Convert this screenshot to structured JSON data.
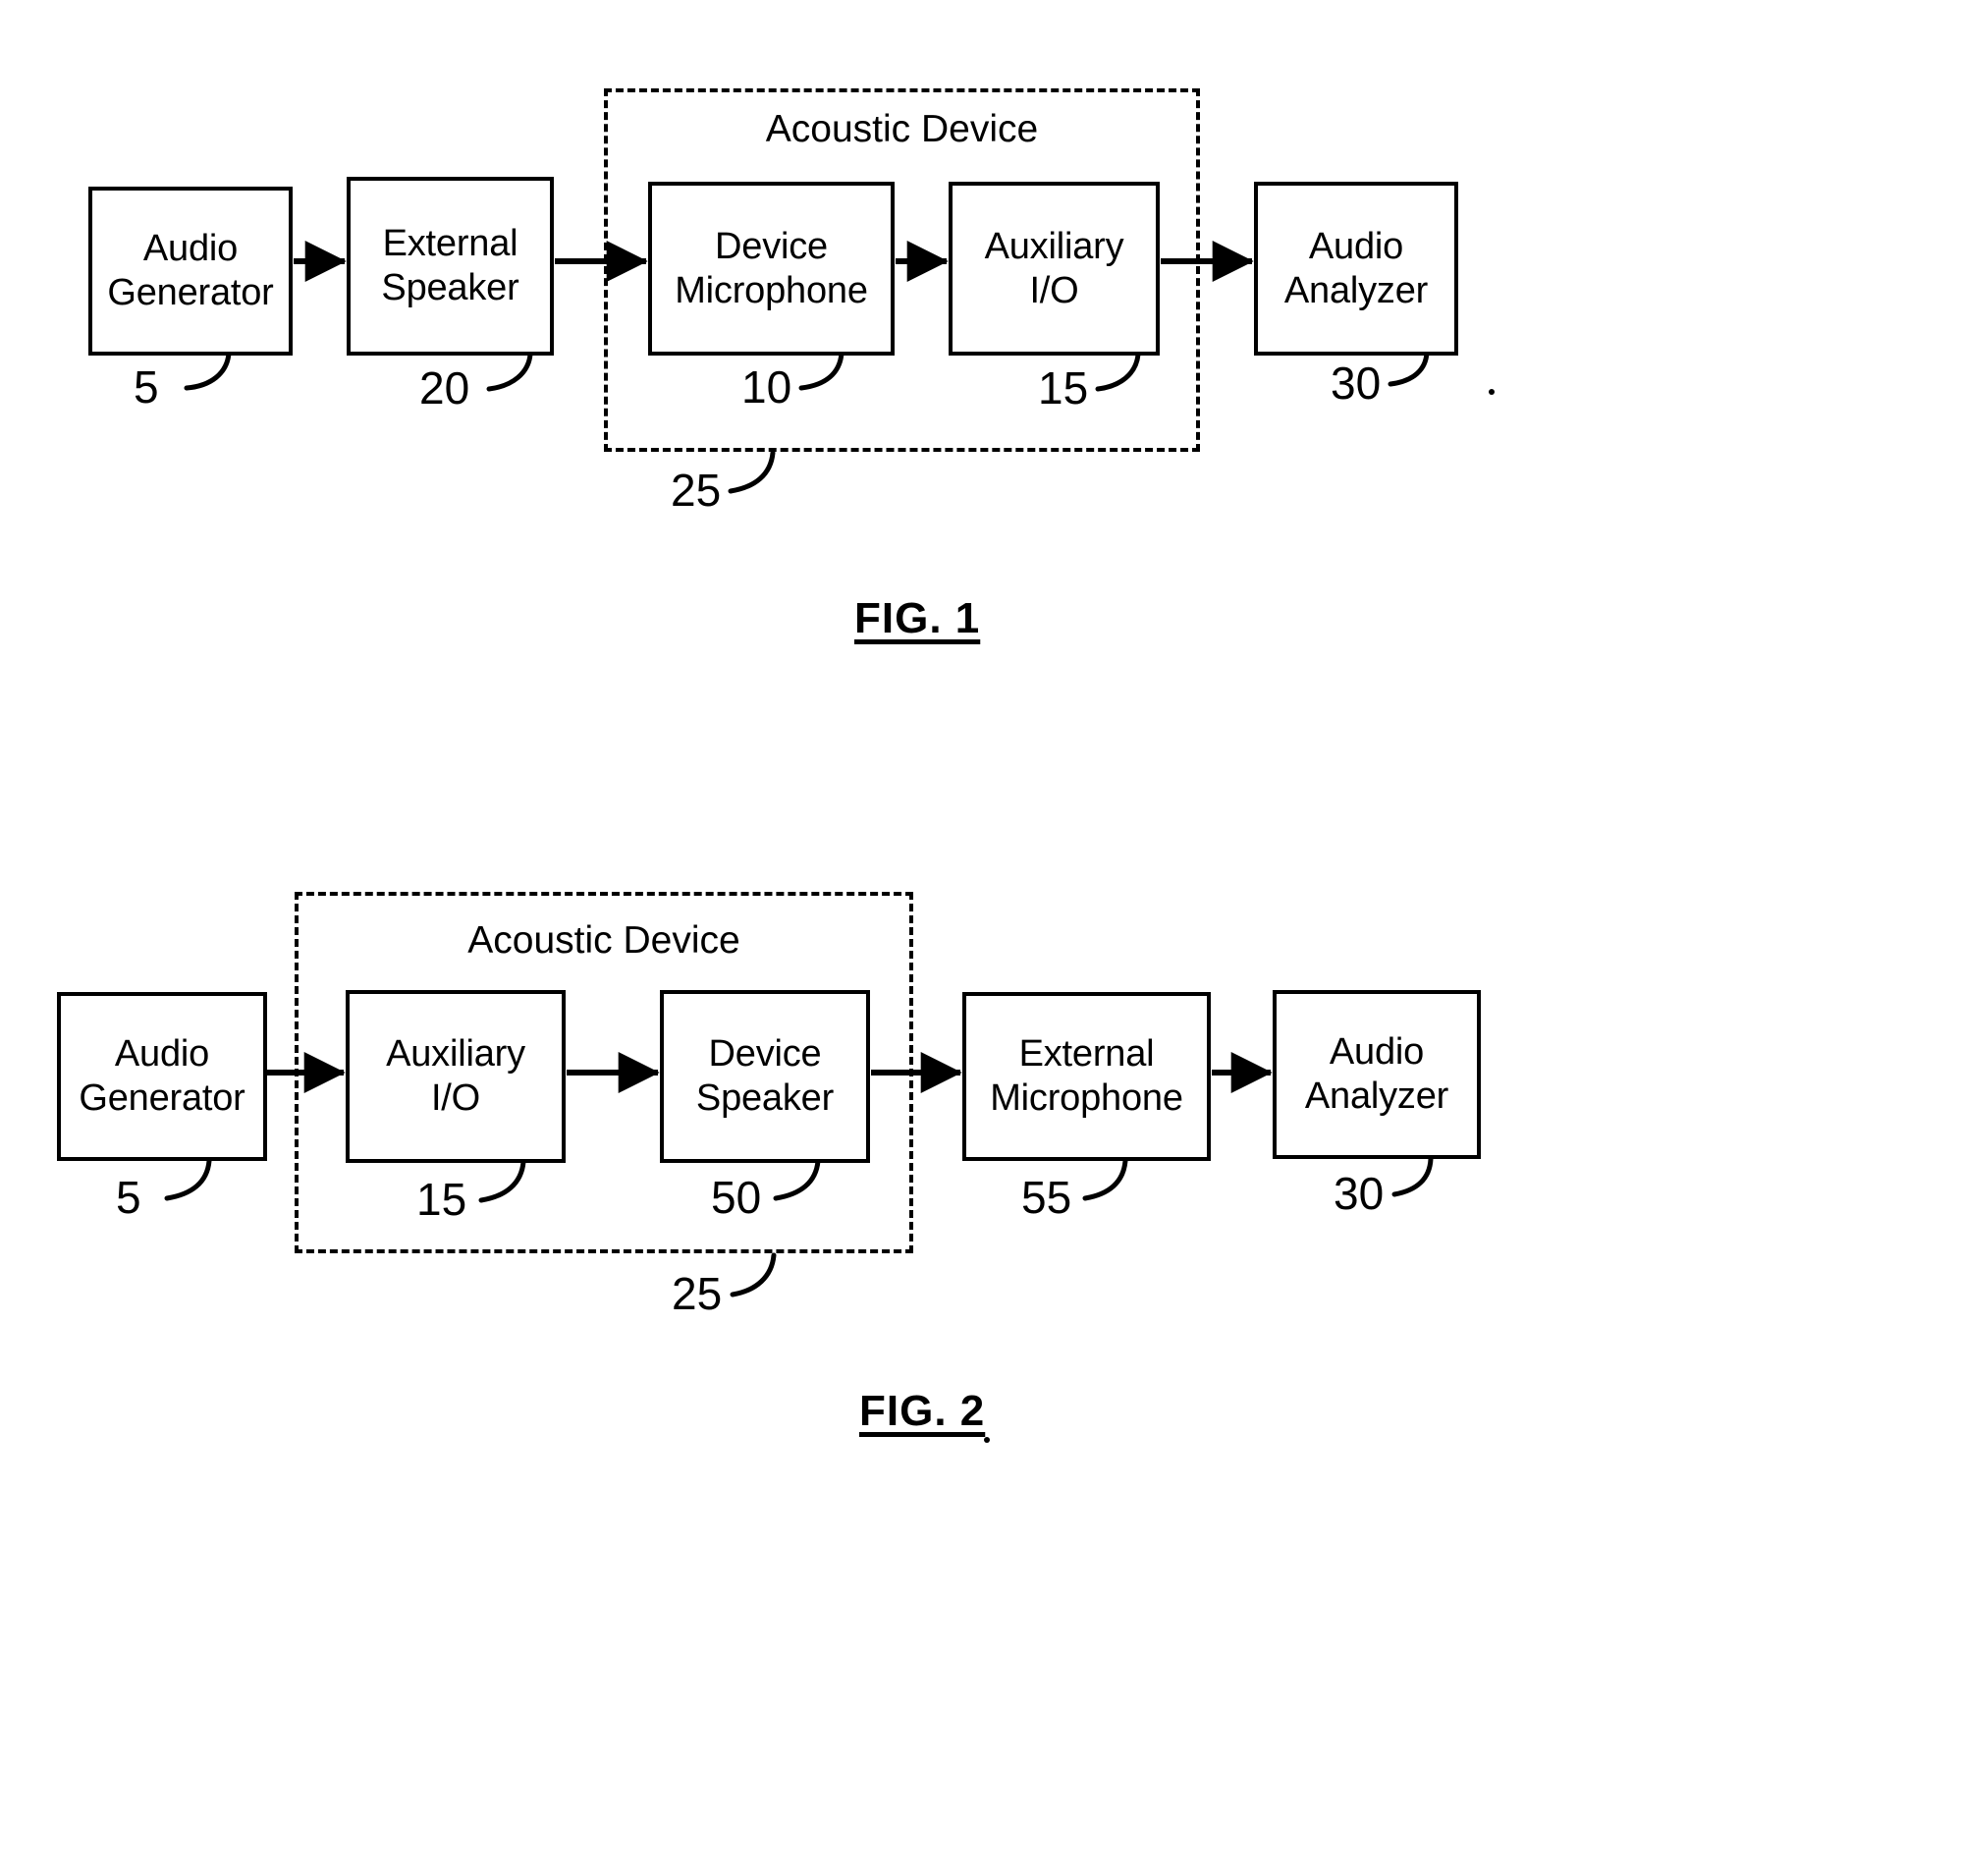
{
  "document": {
    "type": "patent-figure-sheet",
    "figure_count": 2
  },
  "figures": [
    {
      "id": "fig1",
      "caption": "FIG. 1",
      "zone": {
        "title": "Acoustic Device",
        "ref": "25"
      },
      "blocks": [
        {
          "id": "audio-generator",
          "label": "Audio\nGenerator",
          "ref": "5"
        },
        {
          "id": "external-speaker",
          "label": "External\nSpeaker",
          "ref": "20"
        },
        {
          "id": "device-microphone",
          "label": "Device\nMicrophone",
          "ref": "10"
        },
        {
          "id": "auxiliary-io",
          "label": "Auxiliary\nI/O",
          "ref": "15"
        },
        {
          "id": "audio-analyzer",
          "label": "Audio\nAnalyzer",
          "ref": "30"
        }
      ],
      "flow": [
        "audio-generator",
        "external-speaker",
        "device-microphone",
        "auxiliary-io",
        "audio-analyzer"
      ]
    },
    {
      "id": "fig2",
      "caption": "FIG. 2",
      "zone": {
        "title": "Acoustic Device",
        "ref": "25"
      },
      "blocks": [
        {
          "id": "audio-generator",
          "label": "Audio\nGenerator",
          "ref": "5"
        },
        {
          "id": "auxiliary-io",
          "label": "Auxiliary\nI/O",
          "ref": "15"
        },
        {
          "id": "device-speaker",
          "label": "Device\nSpeaker",
          "ref": "50"
        },
        {
          "id": "external-microphone",
          "label": "External\nMicrophone",
          "ref": "55"
        },
        {
          "id": "audio-analyzer",
          "label": "Audio\nAnalyzer",
          "ref": "30"
        }
      ],
      "flow": [
        "audio-generator",
        "auxiliary-io",
        "device-speaker",
        "external-microphone",
        "audio-analyzer"
      ]
    }
  ],
  "style": {
    "ink": "#000000",
    "paper": "#ffffff"
  }
}
